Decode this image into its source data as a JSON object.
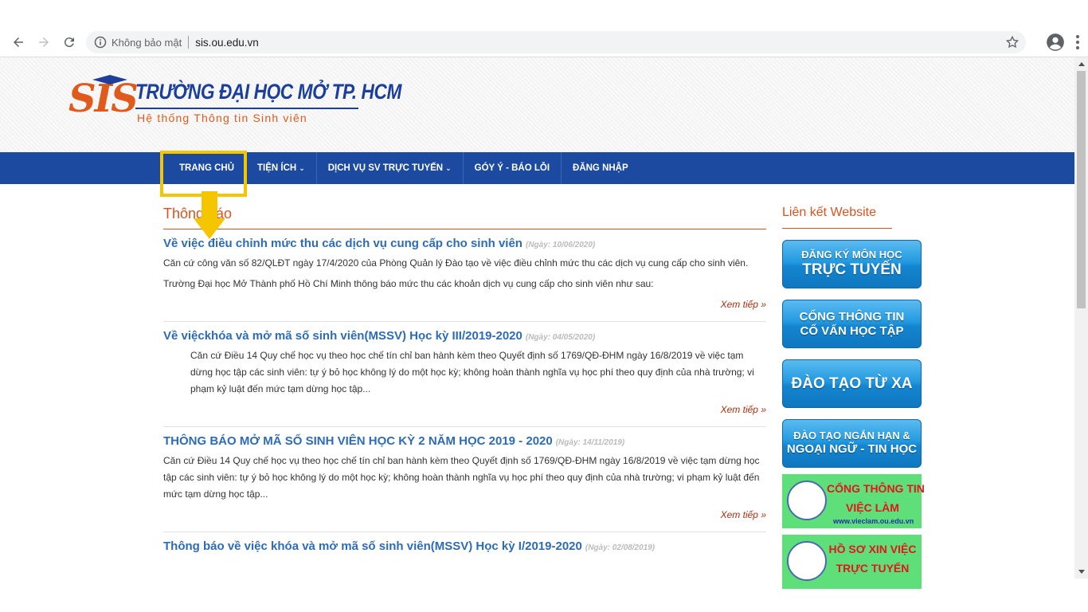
{
  "browser": {
    "security_label": "Không bảo mật",
    "url": "sis.ou.edu.vn"
  },
  "header": {
    "logo_mark": "SIS",
    "school_name": "TRƯỜNG ĐẠI HỌC MỞ TP. HCM",
    "tagline": "Hệ thống Thông tin Sinh viên"
  },
  "nav": {
    "items": [
      {
        "label": "TRANG CHỦ"
      },
      {
        "label": "TIỆN ÍCH"
      },
      {
        "label": "DỊCH VỤ SV TRỰC TUYẾN"
      },
      {
        "label": "GÓY Ý - BÁO LỖI"
      },
      {
        "label": "ĐĂNG NHẬP"
      }
    ],
    "highlight_color": "#f5c500"
  },
  "main": {
    "heading": "Thông báo",
    "more_label": "Xem tiếp »",
    "posts": [
      {
        "title": "Về việc điều chỉnh mức thu các dịch vụ cung cấp cho sinh viên",
        "date": "(Ngày: 10/06/2020)",
        "para1": "Căn cứ công văn số 82/QLĐT ngày 17/4/2020 của Phòng Quản lý Đào tạo về việc điều chỉnh mức thu các dịch vụ cung cấp cho sinh viên.",
        "para2": "Trường Đại học Mở Thành phố Hồ Chí Minh thông báo mức thu các khoản dịch vụ cung cấp cho sinh viên như sau:"
      },
      {
        "title": "Về việckhóa và mở mã số sinh viên(MSSV) Học kỳ III/2019-2020",
        "date": "(Ngày: 04/05/2020)",
        "para1": "Căn cứ Điều 14 Quy chế học vụ theo học chế tín chỉ ban hành kèm theo Quyết định số 1769/QĐ-ĐHM ngày 16/8/2019 về việc tạm dừng học tập các sinh viên: tự ý bỏ học không lý do một học kỳ; không hoàn thành nghĩa vụ học phí theo quy định của nhà trường; vi phạm kỷ luật đến mức tạm dừng học tập..."
      },
      {
        "title": "THÔNG BÁO MỞ MÃ SỐ SINH VIÊN HỌC KỲ 2 NĂM HỌC 2019 - 2020",
        "date": "(Ngày: 14/11/2019)",
        "para1": "Căn cứ Điều 14 Quy chế học vụ theo học chế tín chỉ ban hành kèm theo Quyết định số 1769/QĐ-ĐHM ngày 16/8/2019 về việc tạm dừng học tập các sinh viên: tự ý bỏ học không lý do một học kỳ; không hoàn thành nghĩa vụ học phí theo quy định của nhà trường; vi phạm kỷ luật đến mức tạm dừng học tập..."
      },
      {
        "title": "Thông báo về việc khóa và mở mã số sinh viên(MSSV) Học kỳ I/2019-2020",
        "date": "(Ngày: 02/08/2019)"
      }
    ]
  },
  "sidebar": {
    "heading": "Liên kết Website",
    "buttons": [
      {
        "line1": "ĐĂNG KÝ MÔN HỌC",
        "line2": "TRỰC TUYẾN"
      },
      {
        "line1": "CỔNG THÔNG TIN",
        "line2": "CỐ VẤN HỌC TẬP"
      },
      {
        "line1": "ĐÀO TẠO TỪ XA"
      },
      {
        "line1": "ĐÀO TẠO NGẮN HẠN &",
        "line2": "NGOẠI NGỮ - TIN HỌC"
      }
    ],
    "banners": [
      {
        "line1": "CỔNG THÔNG TIN",
        "line2": "VIỆC LÀM",
        "url": "www.vieclam.ou.edu.vn"
      },
      {
        "line1": "HỒ SƠ XIN VIỆC",
        "line2": "TRỰC TUYẾN"
      }
    ]
  }
}
